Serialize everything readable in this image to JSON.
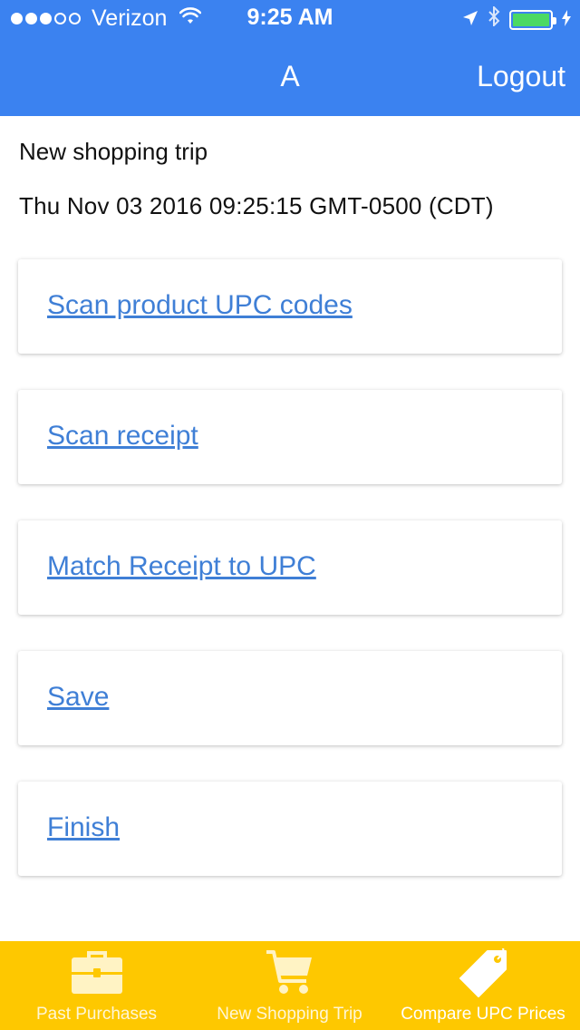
{
  "status_bar": {
    "carrier": "Verizon",
    "time": "9:25 AM",
    "signal_bars": 3,
    "signal_total": 5
  },
  "header": {
    "title": "A",
    "logout_label": "Logout"
  },
  "trip": {
    "title": "New shopping trip",
    "datetime": "Thu Nov 03 2016 09:25:15 GMT-0500 (CDT)"
  },
  "actions": [
    {
      "label": "Scan product UPC codes"
    },
    {
      "label": "Scan receipt"
    },
    {
      "label": "Match Receipt to UPC"
    },
    {
      "label": "Save"
    },
    {
      "label": "Finish"
    }
  ],
  "tabbar": {
    "tabs": [
      {
        "label": "Past Purchases",
        "icon": "briefcase-icon"
      },
      {
        "label": "New Shopping Trip",
        "icon": "cart-icon"
      },
      {
        "label": "Compare UPC Prices",
        "icon": "price-tag-icon",
        "active": true
      }
    ]
  },
  "colors": {
    "header_bg": "#3b82f0",
    "link": "#3f7fd6",
    "tabbar_bg": "#fec800",
    "battery": "#4cd964"
  }
}
